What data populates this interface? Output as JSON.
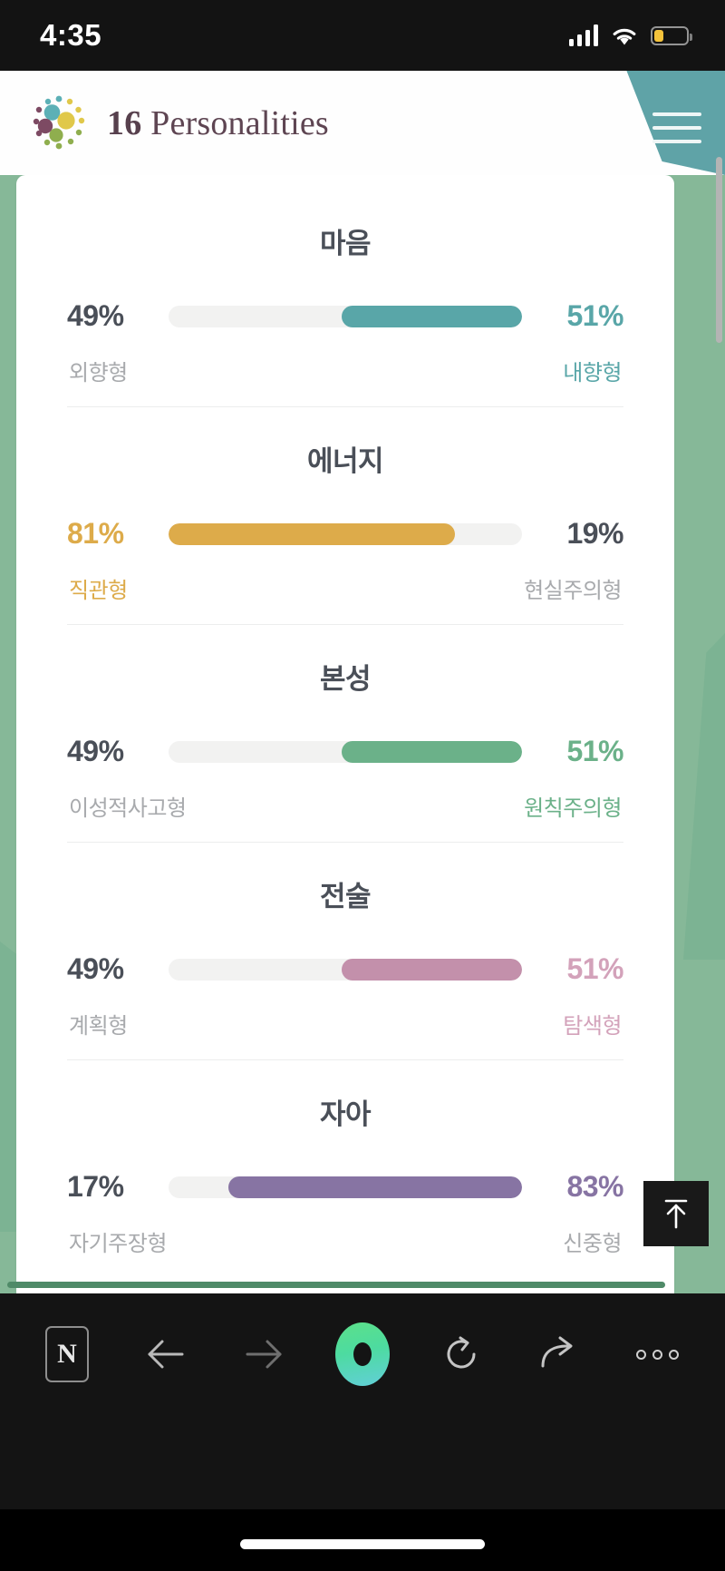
{
  "status_bar": {
    "time": "4:35",
    "signal_icon": "cellular-signal-icon",
    "wifi_icon": "wifi-icon",
    "battery_icon": "battery-low-icon",
    "battery_level_pct": 28
  },
  "site_header": {
    "brand_prefix": "16",
    "brand_suffix": "Personalities",
    "logo_icon": "16personalities-logo-icon",
    "menu_icon": "hamburger-menu-icon",
    "menu_bg_color": "#5fa3a7"
  },
  "chart_data": {
    "type": "bar",
    "title": "",
    "categories": [
      "마음",
      "에너지",
      "본성",
      "전술",
      "자아"
    ],
    "series": [
      {
        "name": "left",
        "values": [
          49,
          81,
          49,
          49,
          17
        ]
      },
      {
        "name": "right",
        "values": [
          51,
          19,
          51,
          51,
          83
        ]
      }
    ],
    "xlabel": "",
    "ylabel": "",
    "ylim": [
      0,
      100
    ],
    "grid": false,
    "legend": "none"
  },
  "traits": [
    {
      "title": "마음",
      "left_pct": "49%",
      "right_pct": "51%",
      "left_label": "외향형",
      "right_label": "내향형",
      "fill_value": 51,
      "fill_side": "right",
      "color": "#59a6a8",
      "highlight": "right"
    },
    {
      "title": "에너지",
      "left_pct": "81%",
      "right_pct": "19%",
      "left_label": "직관형",
      "right_label": "현실주의형",
      "fill_value": 81,
      "fill_side": "left",
      "color": "#ddab4a",
      "highlight": "left"
    },
    {
      "title": "본성",
      "left_pct": "49%",
      "right_pct": "51%",
      "left_label": "이성적사고형",
      "right_label": "원칙주의형",
      "fill_value": 51,
      "fill_side": "right",
      "color": "#6bb189",
      "highlight": "right"
    },
    {
      "title": "전술",
      "left_pct": "49%",
      "right_pct": "51%",
      "left_label": "계획형",
      "right_label": "탐색형",
      "fill_value": 51,
      "fill_side": "right",
      "color": "#c390ab",
      "highlight": "right"
    },
    {
      "title": "자아",
      "left_pct": "17%",
      "right_pct": "83%",
      "left_label": "자기주장형",
      "right_label": "신중형",
      "fill_value": 83,
      "fill_side": "right",
      "color": "#8774a3",
      "highlight": "none"
    }
  ],
  "floating": {
    "scroll_top_icon": "scroll-to-top-arrow-icon"
  },
  "browser_bar": {
    "buttons": [
      {
        "name": "naver-n-button",
        "label": "N",
        "icon": "naver-n-icon"
      },
      {
        "name": "back-button",
        "label": "",
        "icon": "arrow-left-icon"
      },
      {
        "name": "forward-button",
        "label": "",
        "icon": "arrow-right-icon"
      },
      {
        "name": "naver-home-button",
        "label": "",
        "icon": "naver-home-icon"
      },
      {
        "name": "reload-button",
        "label": "",
        "icon": "refresh-icon"
      },
      {
        "name": "share-button",
        "label": "",
        "icon": "share-arrow-icon"
      },
      {
        "name": "more-options-button",
        "label": "",
        "icon": "more-horizontal-icon"
      }
    ]
  },
  "theme": {
    "page_bg": "#86b898",
    "card_bg": "#ffffff",
    "track_color": "#f2f2f1",
    "dim_text": "#a8aaad",
    "title_text": "#4a4f58"
  }
}
